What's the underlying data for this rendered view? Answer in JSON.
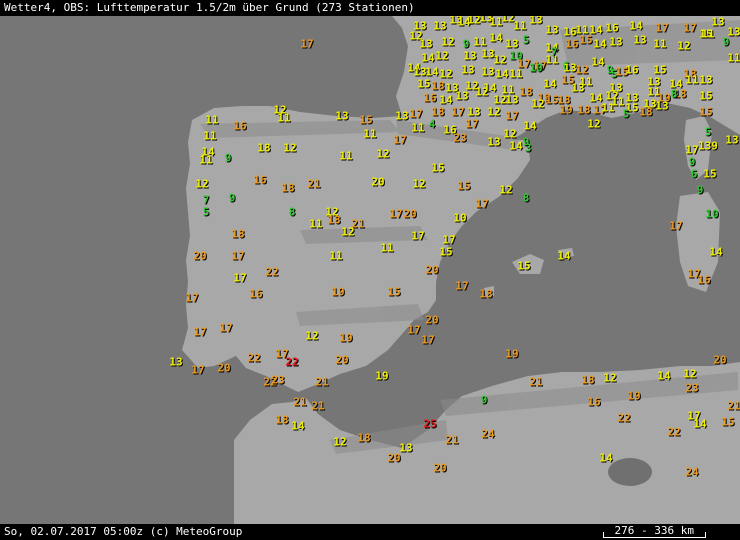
{
  "header": {
    "title": "Wetter4, OBS: Lufttemperatur 1.5/2m über Grund (273 Stationen)"
  },
  "footer": {
    "timestamp": "So, 02.07.2017 05:00z (c) MeteoGroup",
    "scale": "276 - 336 km"
  },
  "colors": {
    "sea": "#767676",
    "land": "#a8a8a8",
    "shade": "#8a8a8a",
    "bar": "#000000",
    "t_green": "#2ec82e",
    "t_yellow": "#f0f000",
    "t_orange": "#ec9a1e",
    "t_red": "#e81a1a"
  },
  "stations": [
    {
      "t": "13",
      "c": "y"
    },
    {
      "t": "13",
      "c": "y"
    },
    {
      "t": "13",
      "c": "y"
    },
    {
      "t": "14",
      "c": "y"
    },
    {
      "t": "12",
      "c": "y"
    },
    {
      "t": "13",
      "c": "y"
    },
    {
      "t": "11",
      "c": "y"
    },
    {
      "t": "12",
      "c": "y"
    },
    {
      "t": "11",
      "c": "y"
    },
    {
      "t": "13",
      "c": "y"
    },
    {
      "t": "13",
      "c": "y"
    },
    {
      "t": "16",
      "c": "y"
    },
    {
      "t": "11",
      "c": "y"
    },
    {
      "t": "14",
      "c": "y"
    },
    {
      "t": "16",
      "c": "y"
    },
    {
      "t": "14",
      "c": "y"
    },
    {
      "t": "17",
      "c": "o"
    },
    {
      "t": "17",
      "c": "o"
    },
    {
      "t": "15",
      "c": "y"
    },
    {
      "t": "13",
      "c": "y"
    },
    {
      "t": "13",
      "c": "y"
    },
    {
      "t": "12",
      "c": "y"
    },
    {
      "t": "13",
      "c": "y"
    },
    {
      "t": "12",
      "c": "y"
    },
    {
      "t": "9",
      "c": "g"
    },
    {
      "t": "11",
      "c": "y"
    },
    {
      "t": "14",
      "c": "y"
    },
    {
      "t": "13",
      "c": "y"
    },
    {
      "t": "5",
      "c": "g"
    },
    {
      "t": "14",
      "c": "y"
    },
    {
      "t": "16",
      "c": "o"
    },
    {
      "t": "15",
      "c": "o"
    },
    {
      "t": "14",
      "c": "y"
    },
    {
      "t": "13",
      "c": "y"
    },
    {
      "t": "13",
      "c": "y"
    },
    {
      "t": "11",
      "c": "y"
    },
    {
      "t": "12",
      "c": "y"
    },
    {
      "t": "11",
      "c": "y"
    },
    {
      "t": "9",
      "c": "g"
    },
    {
      "t": "11",
      "c": "y"
    },
    {
      "t": "11",
      "c": "y"
    },
    {
      "t": "17",
      "c": "o"
    },
    {
      "t": "14",
      "c": "y"
    },
    {
      "t": "12",
      "c": "y"
    },
    {
      "t": "13",
      "c": "y"
    },
    {
      "t": "13",
      "c": "y"
    },
    {
      "t": "12",
      "c": "y"
    },
    {
      "t": "10",
      "c": "g"
    },
    {
      "t": "17",
      "c": "o"
    },
    {
      "t": "17",
      "c": "o"
    },
    {
      "t": "7",
      "c": "g"
    },
    {
      "t": "6",
      "c": "g"
    },
    {
      "t": "13",
      "c": "y"
    },
    {
      "t": "12",
      "c": "o"
    },
    {
      "t": "14",
      "c": "y"
    },
    {
      "t": "9",
      "c": "g"
    },
    {
      "t": "5",
      "c": "g"
    },
    {
      "t": "15",
      "c": "o"
    },
    {
      "t": "16",
      "c": "y"
    },
    {
      "t": "15",
      "c": "y"
    },
    {
      "t": "18",
      "c": "o"
    },
    {
      "t": "13",
      "c": "y"
    },
    {
      "t": "14",
      "c": "y"
    },
    {
      "t": "13",
      "c": "y"
    },
    {
      "t": "14",
      "c": "y"
    },
    {
      "t": "12",
      "c": "y"
    },
    {
      "t": "13",
      "c": "y"
    },
    {
      "t": "13",
      "c": "y"
    },
    {
      "t": "14",
      "c": "y"
    },
    {
      "t": "11",
      "c": "y"
    },
    {
      "t": "10",
      "c": "g"
    },
    {
      "t": "14",
      "c": "y"
    },
    {
      "t": "15",
      "c": "o"
    },
    {
      "t": "11",
      "c": "y"
    },
    {
      "t": "13",
      "c": "y"
    },
    {
      "t": "13",
      "c": "y"
    },
    {
      "t": "14",
      "c": "y"
    },
    {
      "t": "11",
      "c": "y"
    },
    {
      "t": "15",
      "c": "y"
    },
    {
      "t": "18",
      "c": "o"
    },
    {
      "t": "13",
      "c": "y"
    },
    {
      "t": "12",
      "c": "y"
    },
    {
      "t": "14",
      "c": "y"
    },
    {
      "t": "11",
      "c": "y"
    },
    {
      "t": "18",
      "c": "o"
    },
    {
      "t": "19",
      "c": "o"
    },
    {
      "t": "15",
      "c": "o"
    },
    {
      "t": "18",
      "c": "o"
    },
    {
      "t": "13",
      "c": "y"
    },
    {
      "t": "14",
      "c": "y"
    },
    {
      "t": "12",
      "c": "y"
    },
    {
      "t": "13",
      "c": "y"
    },
    {
      "t": "11",
      "c": "y"
    },
    {
      "t": "19",
      "c": "o"
    },
    {
      "t": "18",
      "c": "o"
    },
    {
      "t": "15",
      "c": "y"
    },
    {
      "t": "16",
      "c": "o"
    },
    {
      "t": "14",
      "c": "y"
    },
    {
      "t": "13",
      "c": "y"
    },
    {
      "t": "12",
      "c": "y"
    },
    {
      "t": "12",
      "c": "y"
    },
    {
      "t": "13",
      "c": "y"
    },
    {
      "t": "12",
      "c": "y"
    },
    {
      "t": "19",
      "c": "o"
    },
    {
      "t": "18",
      "c": "o"
    },
    {
      "t": "17",
      "c": "o"
    },
    {
      "t": "11",
      "c": "y"
    },
    {
      "t": "11",
      "c": "y"
    },
    {
      "t": "15",
      "c": "y"
    },
    {
      "t": "13",
      "c": "y"
    },
    {
      "t": "13",
      "c": "y"
    },
    {
      "t": "8",
      "c": "g"
    },
    {
      "t": "15",
      "c": "o"
    },
    {
      "t": "18",
      "c": "o"
    },
    {
      "t": "17",
      "c": "o"
    },
    {
      "t": "18",
      "c": "o"
    },
    {
      "t": "17",
      "c": "o"
    },
    {
      "t": "13",
      "c": "y"
    },
    {
      "t": "12",
      "c": "y"
    },
    {
      "t": "17",
      "c": "o"
    },
    {
      "t": "14",
      "c": "y"
    },
    {
      "t": "12",
      "c": "y"
    },
    {
      "t": "5",
      "c": "g"
    },
    {
      "t": "12",
      "c": "y"
    },
    {
      "t": "11",
      "c": "y"
    },
    {
      "t": "13",
      "c": "y"
    },
    {
      "t": "15",
      "c": "o"
    },
    {
      "t": "13",
      "c": "y"
    },
    {
      "t": "11",
      "c": "y"
    },
    {
      "t": "4",
      "c": "g"
    },
    {
      "t": "16",
      "c": "y"
    },
    {
      "t": "23",
      "c": "o"
    },
    {
      "t": "17",
      "c": "o"
    },
    {
      "t": "13",
      "c": "y"
    },
    {
      "t": "12",
      "c": "y"
    },
    {
      "t": "9",
      "c": "g"
    },
    {
      "t": "3",
      "c": "g"
    },
    {
      "t": "5",
      "c": "g"
    },
    {
      "t": "13",
      "c": "y"
    },
    {
      "t": "11",
      "c": "y"
    },
    {
      "t": "11",
      "c": "y"
    },
    {
      "t": "16",
      "c": "o"
    },
    {
      "t": "18",
      "c": "y"
    },
    {
      "t": "12",
      "c": "y"
    },
    {
      "t": "11",
      "c": "y"
    },
    {
      "t": "11",
      "c": "y"
    },
    {
      "t": "12",
      "c": "y"
    },
    {
      "t": "17",
      "c": "o"
    },
    {
      "t": "15",
      "c": "y"
    },
    {
      "t": "14",
      "c": "y"
    },
    {
      "t": "17",
      "c": "y"
    },
    {
      "t": "139",
      "c": "y"
    },
    {
      "t": "14",
      "c": "y"
    },
    {
      "t": "11",
      "c": "y"
    },
    {
      "t": "9",
      "c": "g"
    },
    {
      "t": "9",
      "c": "g"
    },
    {
      "t": "6",
      "c": "g"
    },
    {
      "t": "15",
      "c": "y"
    },
    {
      "t": "12",
      "c": "y"
    },
    {
      "t": "16",
      "c": "o"
    },
    {
      "t": "18",
      "c": "o"
    },
    {
      "t": "21",
      "c": "o"
    },
    {
      "t": "20",
      "c": "y"
    },
    {
      "t": "12",
      "c": "y"
    },
    {
      "t": "15",
      "c": "o"
    },
    {
      "t": "12",
      "c": "y"
    },
    {
      "t": "8",
      "c": "g"
    },
    {
      "t": "9",
      "c": "g"
    },
    {
      "t": "7",
      "c": "g"
    },
    {
      "t": "9",
      "c": "g"
    },
    {
      "t": "5",
      "c": "g"
    },
    {
      "t": "8",
      "c": "g"
    },
    {
      "t": "11",
      "c": "y"
    },
    {
      "t": "12",
      "c": "y"
    },
    {
      "t": "18",
      "c": "o"
    },
    {
      "t": "17",
      "c": "o"
    },
    {
      "t": "20",
      "c": "o"
    },
    {
      "t": "21",
      "c": "o"
    },
    {
      "t": "12",
      "c": "y"
    },
    {
      "t": "10",
      "c": "y"
    },
    {
      "t": "17",
      "c": "o"
    },
    {
      "t": "10",
      "c": "g"
    },
    {
      "t": "17",
      "c": "o"
    },
    {
      "t": "18",
      "c": "o"
    },
    {
      "t": "17",
      "c": "y"
    },
    {
      "t": "17",
      "c": "y"
    },
    {
      "t": "11",
      "c": "y"
    },
    {
      "t": "15",
      "c": "y"
    },
    {
      "t": "14",
      "c": "y"
    },
    {
      "t": "20",
      "c": "o"
    },
    {
      "t": "17",
      "c": "o"
    },
    {
      "t": "15",
      "c": "y"
    },
    {
      "t": "14",
      "c": "y"
    },
    {
      "t": "11",
      "c": "y"
    },
    {
      "t": "22",
      "c": "o"
    },
    {
      "t": "17",
      "c": "y"
    },
    {
      "t": "20",
      "c": "o"
    },
    {
      "t": "17",
      "c": "o"
    },
    {
      "t": "16",
      "c": "o"
    },
    {
      "t": "19",
      "c": "o"
    },
    {
      "t": "15",
      "c": "o"
    },
    {
      "t": "17",
      "c": "o"
    },
    {
      "t": "18",
      "c": "o"
    },
    {
      "t": "16",
      "c": "o"
    },
    {
      "t": "17",
      "c": "o"
    },
    {
      "t": "17",
      "c": "o"
    },
    {
      "t": "17",
      "c": "o"
    },
    {
      "t": "12",
      "c": "y"
    },
    {
      "t": "19",
      "c": "o"
    },
    {
      "t": "17",
      "c": "o"
    },
    {
      "t": "20",
      "c": "o"
    },
    {
      "t": "17",
      "c": "o"
    },
    {
      "t": "13",
      "c": "y"
    },
    {
      "t": "17",
      "c": "o"
    },
    {
      "t": "20",
      "c": "o"
    },
    {
      "t": "22",
      "c": "o"
    },
    {
      "t": "17",
      "c": "o"
    },
    {
      "t": "22",
      "c": "r"
    },
    {
      "t": "20",
      "c": "o"
    },
    {
      "t": "19",
      "c": "y"
    },
    {
      "t": "22",
      "c": "o"
    },
    {
      "t": "23",
      "c": "o"
    },
    {
      "t": "21",
      "c": "o"
    },
    {
      "t": "19",
      "c": "o"
    },
    {
      "t": "21",
      "c": "o"
    },
    {
      "t": "18",
      "c": "o"
    },
    {
      "t": "12",
      "c": "y"
    },
    {
      "t": "14",
      "c": "y"
    },
    {
      "t": "12",
      "c": "y"
    },
    {
      "t": "20",
      "c": "o"
    },
    {
      "t": "21",
      "c": "o"
    },
    {
      "t": "21",
      "c": "o"
    },
    {
      "t": "23",
      "c": "o"
    },
    {
      "t": "21",
      "c": "o"
    },
    {
      "t": "18",
      "c": "o"
    },
    {
      "t": "14",
      "c": "y"
    },
    {
      "t": "9",
      "c": "g"
    },
    {
      "t": "16",
      "c": "o"
    },
    {
      "t": "19",
      "c": "o"
    },
    {
      "t": "22",
      "c": "o"
    },
    {
      "t": "17",
      "c": "y"
    },
    {
      "t": "14",
      "c": "y"
    },
    {
      "t": "15",
      "c": "o"
    },
    {
      "t": "25",
      "c": "r"
    },
    {
      "t": "21",
      "c": "o"
    },
    {
      "t": "24",
      "c": "o"
    },
    {
      "t": "22",
      "c": "o"
    },
    {
      "t": "12",
      "c": "y"
    },
    {
      "t": "18",
      "c": "o"
    },
    {
      "t": "13",
      "c": "y"
    },
    {
      "t": "20",
      "c": "o"
    },
    {
      "t": "20",
      "c": "o"
    },
    {
      "t": "14",
      "c": "y"
    },
    {
      "t": "24",
      "c": "o"
    }
  ]
}
